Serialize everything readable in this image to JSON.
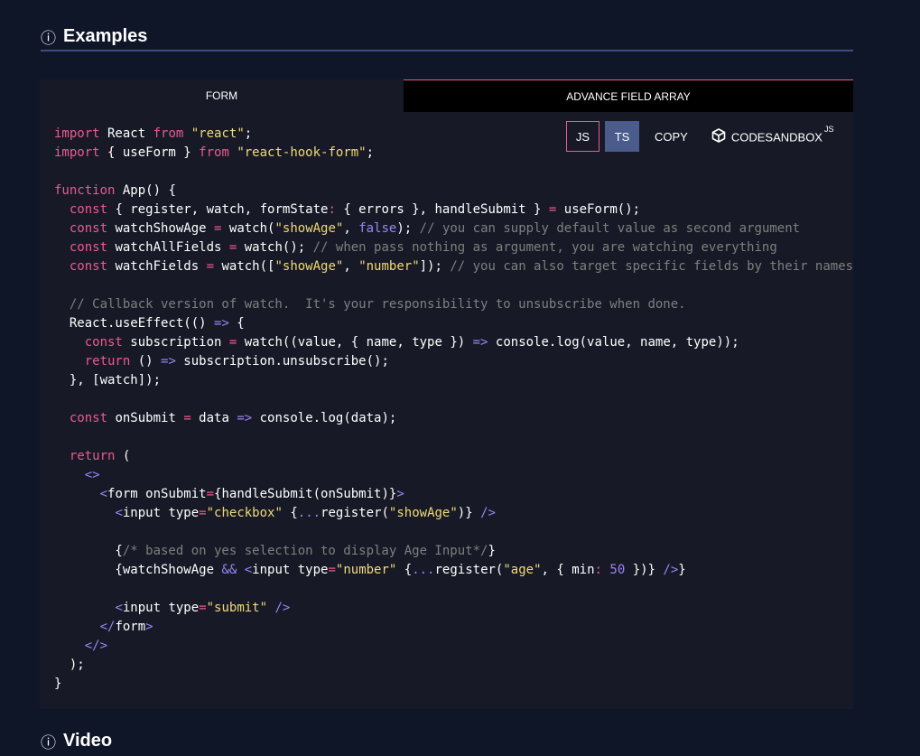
{
  "sections": {
    "examples_title": "Examples",
    "video_title": "Video",
    "info_glyph": "ⓘ"
  },
  "tabs": [
    {
      "label": "FORM"
    },
    {
      "label": "ADVANCE FIELD ARRAY"
    }
  ],
  "toolbar": {
    "js_label": "JS",
    "ts_label": "TS",
    "copy_label": "COPY",
    "codesandbox_label": "CODESANDBOX",
    "codesandbox_sup": "JS"
  },
  "icons": {
    "info": "info-circle-icon",
    "codesandbox": "codesandbox-cube-icon"
  },
  "colors": {
    "background": "#0f1628",
    "panel": "#171a26",
    "accent_pink": "#ec5990",
    "ts_button": "#4a5b8c",
    "string": "#f1d976",
    "comment": "#7f7f7f",
    "punct": "#9b83f5"
  },
  "code_lines": [
    [
      [
        "k",
        "import"
      ],
      [
        "",
        " React "
      ],
      [
        "k",
        "from"
      ],
      [
        "",
        " "
      ],
      [
        "s",
        "\"react\""
      ],
      [
        "",
        ";"
      ]
    ],
    [
      [
        "k",
        "import"
      ],
      [
        "",
        " { useForm } "
      ],
      [
        "k",
        "from"
      ],
      [
        "",
        " "
      ],
      [
        "s",
        "\"react-hook-form\""
      ],
      [
        "",
        ";"
      ]
    ],
    [],
    [
      [
        "k",
        "function"
      ],
      [
        "",
        " App() {"
      ]
    ],
    [
      [
        "",
        "  "
      ],
      [
        "k",
        "const"
      ],
      [
        "",
        " { register, watch, formState"
      ],
      [
        "k",
        ":"
      ],
      [
        "",
        " { errors }, handleSubmit } "
      ],
      [
        "k",
        "="
      ],
      [
        "",
        " useForm();"
      ]
    ],
    [
      [
        "",
        "  "
      ],
      [
        "k",
        "const"
      ],
      [
        "",
        " watchShowAge "
      ],
      [
        "k",
        "="
      ],
      [
        "",
        " watch("
      ],
      [
        "s",
        "\"showAge\""
      ],
      [
        "",
        ", "
      ],
      [
        "p",
        "false"
      ],
      [
        "",
        "); "
      ],
      [
        "c",
        "// you can supply default value as second argument"
      ]
    ],
    [
      [
        "",
        "  "
      ],
      [
        "k",
        "const"
      ],
      [
        "",
        " watchAllFields "
      ],
      [
        "k",
        "="
      ],
      [
        "",
        " watch(); "
      ],
      [
        "c",
        "// when pass nothing as argument, you are watching everything"
      ]
    ],
    [
      [
        "",
        "  "
      ],
      [
        "k",
        "const"
      ],
      [
        "",
        " watchFields "
      ],
      [
        "k",
        "="
      ],
      [
        "",
        " watch(["
      ],
      [
        "s",
        "\"showAge\""
      ],
      [
        "",
        ", "
      ],
      [
        "s",
        "\"number\""
      ],
      [
        "",
        "]); "
      ],
      [
        "c",
        "// you can also target specific fields by their names"
      ]
    ],
    [],
    [
      [
        "",
        "  "
      ],
      [
        "c",
        "// Callback version of watch.  It's your responsibility to unsubscribe when done."
      ]
    ],
    [
      [
        "",
        "  React.useEffect(() "
      ],
      [
        "p",
        "=>"
      ],
      [
        "",
        " {"
      ]
    ],
    [
      [
        "",
        "    "
      ],
      [
        "k",
        "const"
      ],
      [
        "",
        " subscription "
      ],
      [
        "k",
        "="
      ],
      [
        "",
        " watch((value, { name, type }) "
      ],
      [
        "p",
        "=>"
      ],
      [
        "",
        " console.log(value, name, type));"
      ]
    ],
    [
      [
        "",
        "    "
      ],
      [
        "k",
        "return"
      ],
      [
        "",
        " () "
      ],
      [
        "p",
        "=>"
      ],
      [
        "",
        " subscription.unsubscribe();"
      ]
    ],
    [
      [
        "",
        "  }, [watch]);"
      ]
    ],
    [],
    [
      [
        "",
        "  "
      ],
      [
        "k",
        "const"
      ],
      [
        "",
        " onSubmit "
      ],
      [
        "k",
        "="
      ],
      [
        "",
        " data "
      ],
      [
        "p",
        "=>"
      ],
      [
        "",
        " console.log(data);"
      ]
    ],
    [],
    [
      [
        "",
        "  "
      ],
      [
        "k",
        "return"
      ],
      [
        "",
        " ("
      ]
    ],
    [
      [
        "",
        "    "
      ],
      [
        "p",
        "<>"
      ]
    ],
    [
      [
        "",
        "      "
      ],
      [
        "p",
        "<"
      ],
      [
        "",
        "form onSubmit"
      ],
      [
        "k",
        "="
      ],
      [
        "",
        "{handleSubmit(onSubmit)}"
      ],
      [
        "p",
        ">"
      ]
    ],
    [
      [
        "",
        "        "
      ],
      [
        "p",
        "<"
      ],
      [
        "",
        "input type"
      ],
      [
        "k",
        "="
      ],
      [
        "s",
        "\"checkbox\""
      ],
      [
        "",
        " {"
      ],
      [
        "p",
        "..."
      ],
      [
        "",
        "register("
      ],
      [
        "s",
        "\"showAge\""
      ],
      [
        "",
        ")} "
      ],
      [
        "p",
        "/>"
      ]
    ],
    [],
    [
      [
        "",
        "        {"
      ],
      [
        "c",
        "/* based on yes selection to display Age Input*/"
      ],
      [
        "",
        "}"
      ]
    ],
    [
      [
        "",
        "        {watchShowAge "
      ],
      [
        "p",
        "&&"
      ],
      [
        "",
        " "
      ],
      [
        "p",
        "<"
      ],
      [
        "",
        "input type"
      ],
      [
        "k",
        "="
      ],
      [
        "s",
        "\"number\""
      ],
      [
        "",
        " {"
      ],
      [
        "p",
        "..."
      ],
      [
        "",
        "register("
      ],
      [
        "s",
        "\"age\""
      ],
      [
        "",
        ", { min"
      ],
      [
        "k",
        ":"
      ],
      [
        "",
        " "
      ],
      [
        "p",
        "50"
      ],
      [
        "",
        " })} "
      ],
      [
        "p",
        "/>"
      ],
      [
        "",
        "}"
      ]
    ],
    [],
    [
      [
        "",
        "        "
      ],
      [
        "p",
        "<"
      ],
      [
        "",
        "input type"
      ],
      [
        "k",
        "="
      ],
      [
        "s",
        "\"submit\""
      ],
      [
        "",
        " "
      ],
      [
        "p",
        "/>"
      ]
    ],
    [
      [
        "",
        "      "
      ],
      [
        "p",
        "</"
      ],
      [
        "",
        "form"
      ],
      [
        "p",
        ">"
      ]
    ],
    [
      [
        "",
        "    "
      ],
      [
        "p",
        "</>"
      ]
    ],
    [
      [
        "",
        "  );"
      ]
    ],
    [
      [
        "",
        "}"
      ]
    ]
  ]
}
